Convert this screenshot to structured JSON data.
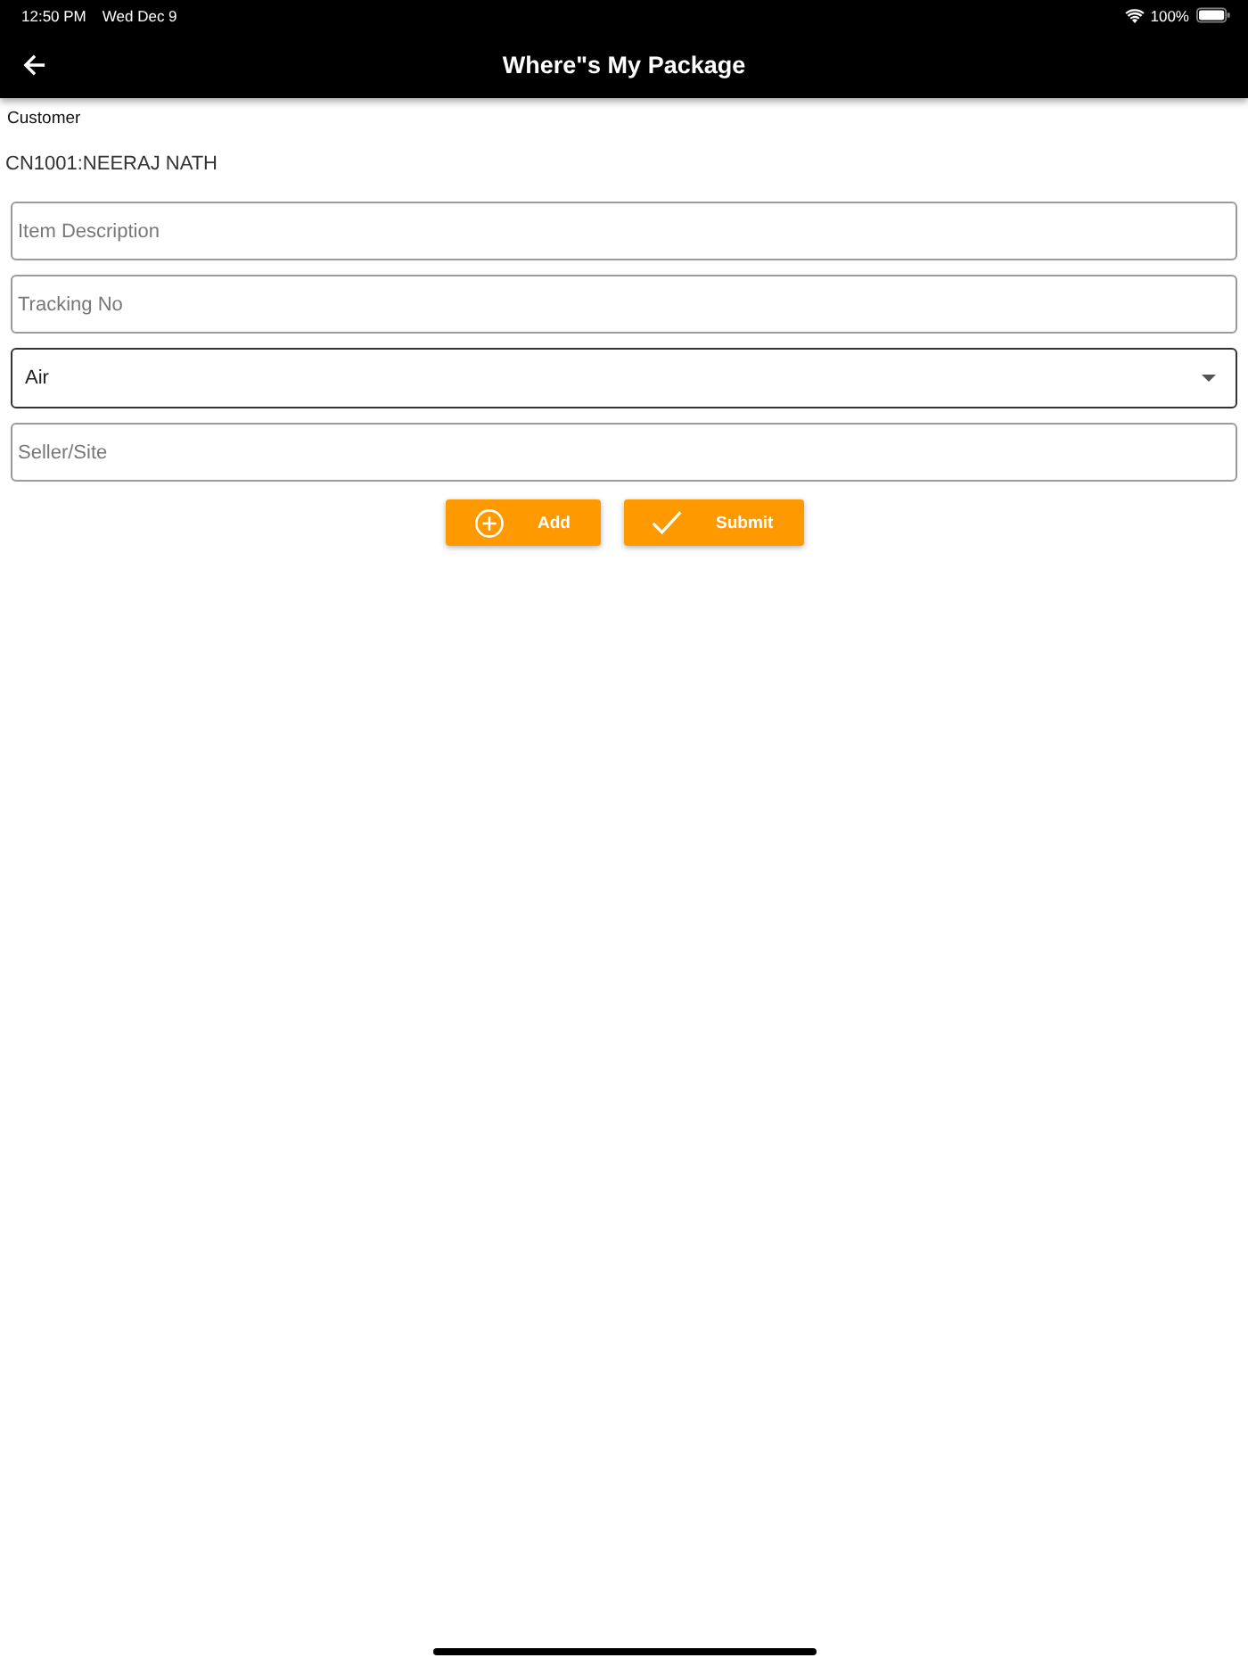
{
  "status_bar": {
    "time": "12:50 PM",
    "date": "Wed Dec 9",
    "battery": "100%"
  },
  "app_bar": {
    "title": "Where\"s My Package"
  },
  "customer": {
    "label": "Customer",
    "value": "CN1001:NEERAJ NATH"
  },
  "fields": [
    {
      "kind": "text",
      "placeholder": "Item Description"
    },
    {
      "kind": "text",
      "placeholder": "Tracking No"
    },
    {
      "kind": "select",
      "value": "Air"
    },
    {
      "kind": "text",
      "placeholder": "Seller/Site"
    }
  ],
  "buttons": [
    {
      "kind": "add",
      "label": "Add"
    },
    {
      "kind": "submit",
      "label": "Submit"
    }
  ]
}
